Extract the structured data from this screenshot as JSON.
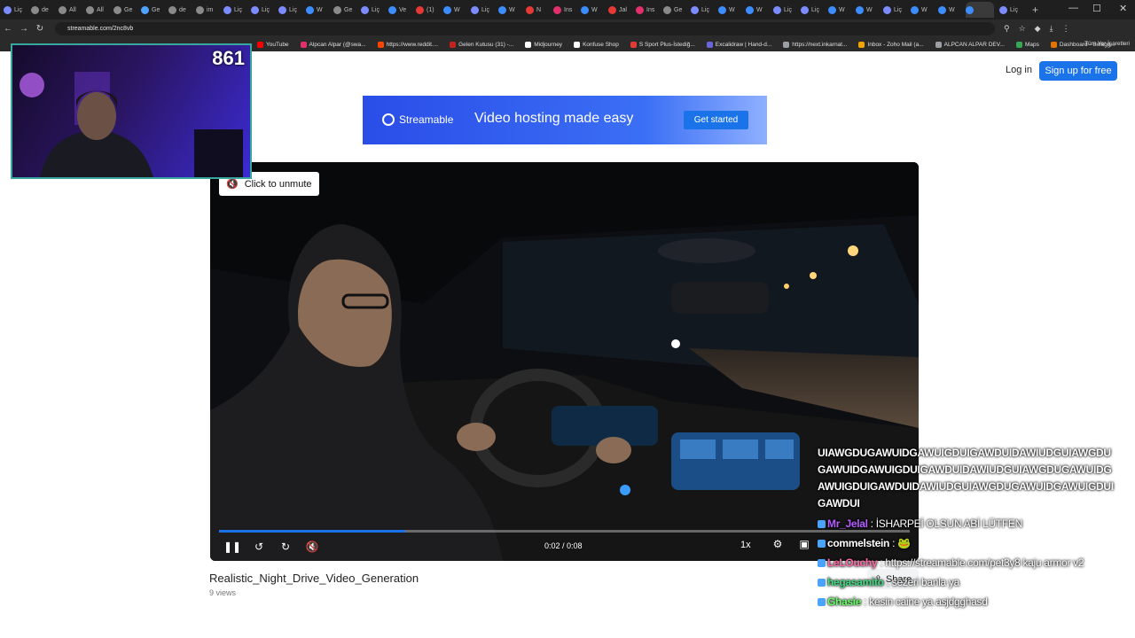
{
  "browser": {
    "tabs": [
      {
        "label": "Liç",
        "color": "#7c8cff"
      },
      {
        "label": "de",
        "color": "#8a8a8a"
      },
      {
        "label": "All",
        "color": "#8a8a8a"
      },
      {
        "label": "All",
        "color": "#8a8a8a"
      },
      {
        "label": "Ge",
        "color": "#8a8a8a"
      },
      {
        "label": "Ge",
        "color": "#4fa3ff"
      },
      {
        "label": "de",
        "color": "#8a8a8a"
      },
      {
        "label": "im",
        "color": "#8a8a8a"
      },
      {
        "label": "Liç",
        "color": "#7c8cff"
      },
      {
        "label": "Liç",
        "color": "#7c8cff"
      },
      {
        "label": "Liç",
        "color": "#7c8cff"
      },
      {
        "label": "W",
        "color": "#3c8dff"
      },
      {
        "label": "Ge",
        "color": "#8a8a8a"
      },
      {
        "label": "Liç",
        "color": "#7c8cff"
      },
      {
        "label": "Ve",
        "color": "#3c8dff"
      },
      {
        "label": "(1)",
        "color": "#e53935"
      },
      {
        "label": "W",
        "color": "#3c8dff"
      },
      {
        "label": "Liç",
        "color": "#7c8cff"
      },
      {
        "label": "W",
        "color": "#3c8dff"
      },
      {
        "label": "N",
        "color": "#e53935"
      },
      {
        "label": "Ins",
        "color": "#e1306c"
      },
      {
        "label": "W",
        "color": "#3c8dff"
      },
      {
        "label": "Jal",
        "color": "#e53935"
      },
      {
        "label": "Ins",
        "color": "#e1306c"
      },
      {
        "label": "Ge",
        "color": "#8a8a8a"
      },
      {
        "label": "Liç",
        "color": "#7c8cff"
      },
      {
        "label": "W",
        "color": "#3c8dff"
      },
      {
        "label": "W",
        "color": "#3c8dff"
      },
      {
        "label": "Liç",
        "color": "#7c8cff"
      },
      {
        "label": "Liç",
        "color": "#7c8cff"
      },
      {
        "label": "W",
        "color": "#3c8dff"
      },
      {
        "label": "W",
        "color": "#3c8dff"
      },
      {
        "label": "Liç",
        "color": "#7c8cff"
      },
      {
        "label": "W",
        "color": "#3c8dff"
      },
      {
        "label": "W",
        "color": "#3c8dff"
      }
    ],
    "active_tab": {
      "label": "",
      "color": "#3c8dff"
    },
    "after_tab": {
      "label": "Liç",
      "color": "#7c8cff"
    },
    "new_tab": "+",
    "url": "streamable.com/2nc8vb",
    "bookmarks": [
      {
        "label": "YouTube",
        "color": "#ff0000"
      },
      {
        "label": "Alpcan Alpar (@swa...",
        "color": "#e1306c"
      },
      {
        "label": "https://www.reddit....",
        "color": "#ff4500"
      },
      {
        "label": "Gelen Kutusu (31) -...",
        "color": "#c5221f"
      },
      {
        "label": "Midjourney",
        "color": "#ffffff"
      },
      {
        "label": "Konfuse Shop",
        "color": "#ffffff"
      },
      {
        "label": "S Sport Plus-İstediğ...",
        "color": "#e53935"
      },
      {
        "label": "Excalidraw | Hand-d...",
        "color": "#6965db"
      },
      {
        "label": "https://next.inkarnat...",
        "color": "#9aa0a6"
      },
      {
        "label": "Inbox - Zoho Mail (a...",
        "color": "#f0a500"
      },
      {
        "label": "ALPCAN ALPAR DEV...",
        "color": "#9aa0a6"
      },
      {
        "label": "Maps",
        "color": "#34a853"
      },
      {
        "label": "Dashboard - Swagg...",
        "color": "#e37400"
      }
    ],
    "bookmarks_all": "Tüm Yer İşaretleri"
  },
  "site": {
    "login": "Log in",
    "signup": "Sign up for free",
    "banner": {
      "brand": "Streamable",
      "tagline": "Video hosting made easy",
      "cta": "Get started"
    }
  },
  "player": {
    "unmute_label": "Click to unmute",
    "time": "0:02 / 0:08",
    "speed": "1x",
    "progress": 0.27
  },
  "video": {
    "title": "Realistic_Night_Drive_Video_Generation",
    "views": "9 views",
    "share": "Share"
  },
  "webcam": {
    "viewer_count": "861"
  },
  "chat": {
    "spam_lines": [
      "UIAWGDUGAWUIDGAWUIGDUIGAWDUIDAWIUDGUIAWGDU",
      "GAWUIDGAWUIGDUIGAWDUIDAWIUDGUIAWGDUGAWUIDG",
      "AWUIGDUIGAWDUIDAWIUDGUIAWGDUGAWUIDGAWUIGDUI",
      "GAWDUI"
    ],
    "messages": [
      {
        "user": "Mr_Jelal",
        "color": "#b45cff",
        "text": " : İSHARPEİ OLSUN ABİ LÜTFEN"
      },
      {
        "user": "commelstein",
        "color": "#ffffff",
        "text": " : 🐸"
      },
      {
        "user": "LeLOuchy",
        "color": "#ff6aa6",
        "text": " : https://streamable.com/pet3y8 kaju armor v2"
      },
      {
        "user": "hegasamito",
        "color": "#3fd97f",
        "text": " : sezeri banla ya"
      },
      {
        "user": "Ghasie",
        "color": "#66ff66",
        "text": " : kesin caine ya asjdgghasd"
      }
    ]
  },
  "colors": {
    "accent": "#1a73e8",
    "progress_track": "#7a7a7a"
  }
}
